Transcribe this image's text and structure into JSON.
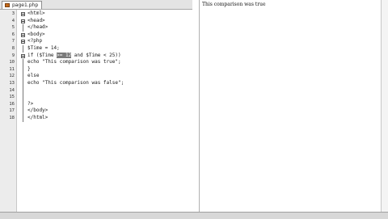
{
  "editor": {
    "tab_label": "page1.php",
    "lines": [
      {
        "num": "3",
        "text": "<html>"
      },
      {
        "num": "4",
        "text": "<head>"
      },
      {
        "num": "5",
        "text": "</head>"
      },
      {
        "num": "6",
        "text": "<body>"
      },
      {
        "num": "7",
        "text": "<?php"
      },
      {
        "num": "8",
        "text": "$Time = 14;"
      },
      {
        "num": "9",
        "text_before": "if ($Time ",
        "text_highlight": ">= 12",
        "text_after": " and $Time < 25))"
      },
      {
        "num": "10",
        "text": "echo \"This comparison was true\";"
      },
      {
        "num": "11",
        "text": "}"
      },
      {
        "num": "12",
        "text": "else"
      },
      {
        "num": "13",
        "text": "echo \"This comparison was false\";"
      },
      {
        "num": "14",
        "text": ""
      },
      {
        "num": "15",
        "text": ""
      },
      {
        "num": "16",
        "text": "?>"
      },
      {
        "num": "17",
        "text": "</body>"
      },
      {
        "num": "18",
        "text": "</html>"
      }
    ]
  },
  "browser": {
    "output_text": "This comparison was true"
  }
}
